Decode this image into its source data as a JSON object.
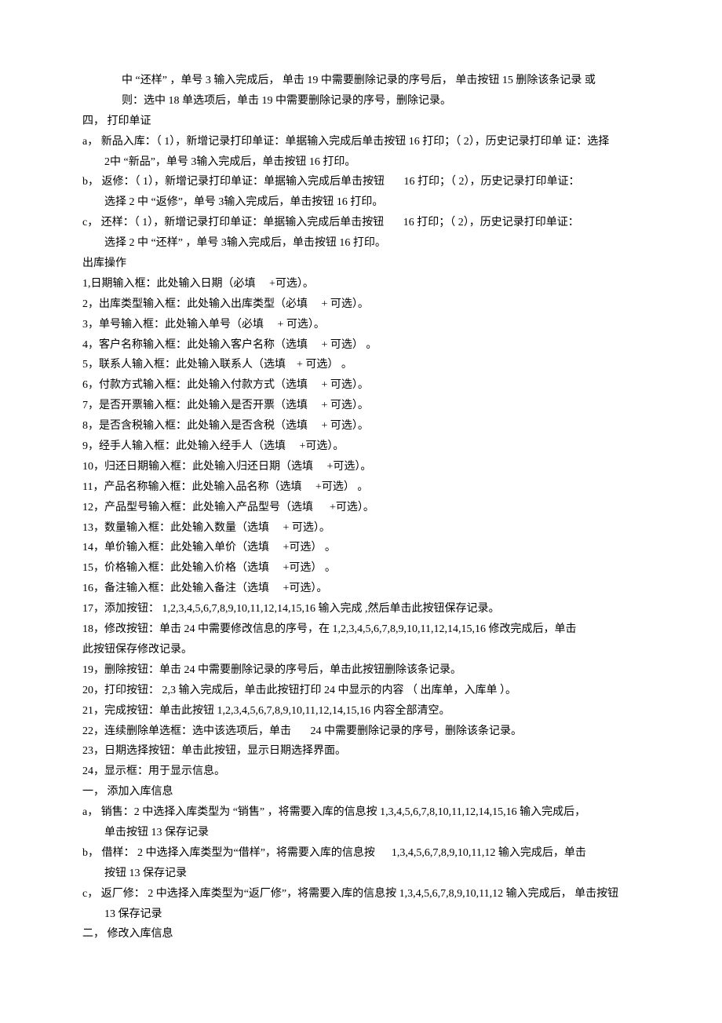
{
  "lines": [
    {
      "cls": "indent1",
      "text": "中 “还样” ，单号 3 输入完成后， 单击 19 中需要删除记录的序号后， 单击按钮 15 删除该条记录 或"
    },
    {
      "cls": "indent1",
      "text": "则：选中 18 单选项后，单击 19 中需要删除记录的序号，删除记录。"
    },
    {
      "cls": "",
      "text": "四， 打印单证"
    },
    {
      "cls": "",
      "text": "a， 新品入库：（ 1），新增记录打印单证：单据输入完成后单击按钮 16 打印；（ 2），历史记录打印单 证：选择"
    },
    {
      "cls": "indent2",
      "text": "2中 “新品”，单号 3输入完成后，单击按钮 16 打印。"
    },
    {
      "cls": "",
      "text": "b， 返修：（ 1），新增记录打印单证：单据输入完成后单击按钮       16 打印；（ 2），历史记录打印单证："
    },
    {
      "cls": "indent2",
      "text": "选择 2 中 “返修”，单号 3输入完成后，单击按钮 16 打印。"
    },
    {
      "cls": "",
      "text": "c， 还样：（ 1），新增记录打印单证：单据输入完成后单击按钮       16 打印；（ 2），历史记录打印单证："
    },
    {
      "cls": "indent2",
      "text": "选择 2 中 “还样” ，单号 3输入完成后，单击按钮 16 打印。"
    },
    {
      "cls": "",
      "text": "出库操作"
    },
    {
      "cls": "",
      "text": "1,日期输入框：此处输入日期（必填     +可选）。"
    },
    {
      "cls": "",
      "text": "2，出库类型输入框：此处输入出库类型（必填     + 可选）。"
    },
    {
      "cls": "",
      "text": "3，单号输入框：此处输入单号（必填     + 可选）。"
    },
    {
      "cls": "",
      "text": "4，客户名称输入框：此处输入客户名称（选填     + 可选） 。"
    },
    {
      "cls": "",
      "text": "5，联系人输入框：此处输入联系人（选填    + 可选） 。"
    },
    {
      "cls": "",
      "text": "6，付款方式输入框：此处输入付款方式（选填     + 可选）。"
    },
    {
      "cls": "",
      "text": "7，是否开票输入框：此处输入是否开票（选填     + 可选）。"
    },
    {
      "cls": "",
      "text": "8，是否含税输入框：此处输入是否含税（选填     + 可选）。"
    },
    {
      "cls": "",
      "text": "9，经手人输入框：此处输入经手人（选填     +可选）。"
    },
    {
      "cls": "",
      "text": "10，归还日期输入框：此处输入归还日期（选填     +可选）。"
    },
    {
      "cls": "",
      "text": "11，产品名称输入框：此处输入品名称（选填     +可选） 。"
    },
    {
      "cls": "",
      "text": "12，产品型号输入框：此处输入产品型号（选填      +可选）。"
    },
    {
      "cls": "",
      "text": "13，数量输入框：此处输入数量（选填     + 可选）。"
    },
    {
      "cls": "",
      "text": "14，单价输入框：此处输入单价（选填     +可选） 。"
    },
    {
      "cls": "",
      "text": "15，价格输入框：此处输入价格（选填     +可选） 。"
    },
    {
      "cls": "",
      "text": "16，备注输入框：此处输入备注（选填     +可选）。"
    },
    {
      "cls": "",
      "text": "17，添加按钮： 1,2,3,4,5,6,7,8,9,10,11,12,14,15,16 输入完成 ,然后单击此按钮保存记录。"
    },
    {
      "cls": "",
      "text": "18，修改按钮：单击 24 中需要修改信息的序号，在 1,2,3,4,5,6,7,8,9,10,11,12,14,15,16 修改完成后，单击"
    },
    {
      "cls": "",
      "text": "此按钮保存修改记录。"
    },
    {
      "cls": "",
      "text": "19，删除按钮：单击 24 中需要删除记录的序号后，单击此按钮删除该条记录。"
    },
    {
      "cls": "",
      "text": "20，打印按钮： 2,3 输入完成后，单击此按钮打印 24 中显示的内容 （ 出库单，入库单 ）。"
    },
    {
      "cls": "",
      "text": "21，完成按钮：单击此按钮 1,2,3,4,5,6,7,8,9,10,11,12,14,15,16 内容全部清空。"
    },
    {
      "cls": "",
      "text": "22，连续删除单选框：选中该选项后，单击       24 中需要删除记录的序号，删除该条记录。"
    },
    {
      "cls": "",
      "text": "23，日期选择按钮：单击此按钮，显示日期选择界面。"
    },
    {
      "cls": "",
      "text": "24，显示框：用于显示信息。"
    },
    {
      "cls": "",
      "text": "一， 添加入库信息"
    },
    {
      "cls": "",
      "text": "a， 销售：2 中选择入库类型为 “销售” ，将需要入库的信息按 1,3,4,5,6,7,8,10,11,12,14,15,16 输入完成后，"
    },
    {
      "cls": "indent2",
      "text": "单击按钮 13 保存记录"
    },
    {
      "cls": "",
      "text": "b， 借样： 2 中选择入库类型为“借样”，将需要入库的信息按      1,3,4,5,6,7,8,9,10,11,12 输入完成后，单击"
    },
    {
      "cls": "indent2",
      "text": "按钮 13 保存记录"
    },
    {
      "cls": "",
      "text": "c， 返厂修： 2 中选择入库类型为“返厂修”，将需要入库的信息按 1,3,4,5,6,7,8,9,10,11,12 输入完成后， 单击按钮"
    },
    {
      "cls": "indent2",
      "text": "13 保存记录"
    },
    {
      "cls": "",
      "text": "二， 修改入库信息"
    }
  ]
}
